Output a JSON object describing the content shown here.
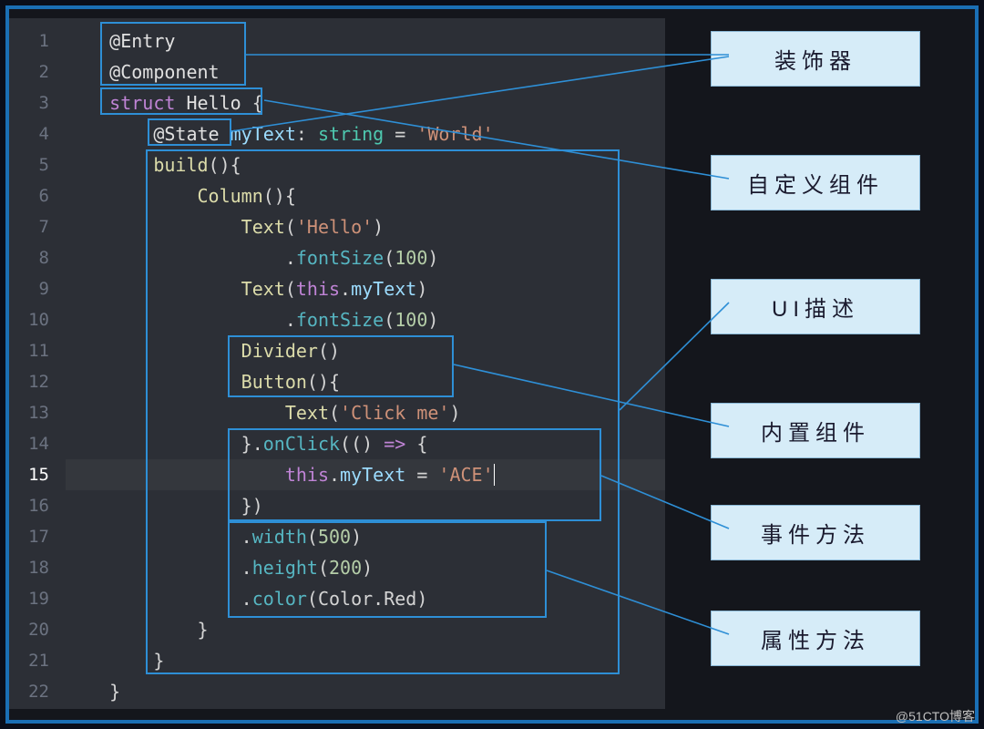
{
  "editor": {
    "lineCount": 22,
    "lines": {
      "l1": "    @Entry",
      "l2": "    @Component",
      "l3": "    struct Hello {",
      "l4": "        @State myText: string = 'World'",
      "l5": "        build(){",
      "l6": "            Column(){",
      "l7": "                Text('Hello')",
      "l8": "                    .fontSize(100)",
      "l9": "                Text(this.myText)",
      "l10": "                    .fontSize(100)",
      "l11": "                Divider()",
      "l12": "                Button(){",
      "l13": "                    Text('Click me')",
      "l14": "                }.onClick(() => {",
      "l15": "                    this.myText = 'ACE'",
      "l16": "                })",
      "l17": "                .width(500)",
      "l18": "                .height(200)",
      "l19": "                .color(Color.Red)",
      "l20": "            }",
      "l21": "        }",
      "l22": "    }"
    }
  },
  "annotations": {
    "decorator": "装饰器",
    "customComponent": "自定义组件",
    "uiDescription": "UI描述",
    "builtinComponent": "内置组件",
    "eventMethod": "事件方法",
    "attributeMethod": "属性方法"
  },
  "boxes": {
    "decorator": {
      "targets": [
        "@Entry",
        "@Component",
        "@State"
      ]
    },
    "customComponent": {
      "targets": [
        "struct Hello"
      ]
    },
    "uiDescription": {
      "targets": [
        "build(){ ... }"
      ]
    },
    "builtinComponent": {
      "targets": [
        "Divider()",
        "Button(){"
      ]
    },
    "eventMethod": {
      "targets": [
        ".onClick(() => { this.myText = 'ACE' })"
      ]
    },
    "attributeMethod": {
      "targets": [
        ".width(500)",
        ".height(200)",
        ".color(Color.Red)"
      ]
    }
  },
  "watermark": "@51CTO博客"
}
